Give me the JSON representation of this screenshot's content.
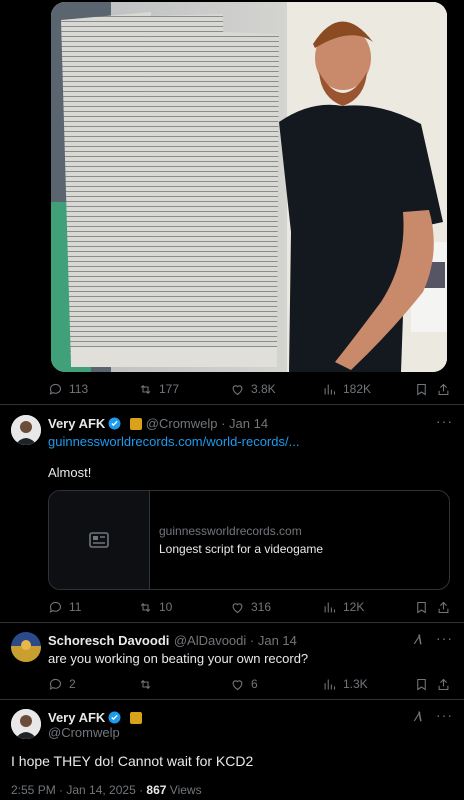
{
  "post1": {
    "stats": {
      "replies": "113",
      "reposts": "177",
      "likes": "3.8K",
      "views": "182K"
    }
  },
  "reply1": {
    "name": "Very AFK",
    "handle": "@Cromwelp · Jan 14",
    "link": "guinnessworldrecords.com/world-records/...",
    "text": "Almost!",
    "card": {
      "domain": "guinnessworldrecords.com",
      "title": "Longest script for a videogame"
    },
    "stats": {
      "replies": "11",
      "reposts": "10",
      "likes": "316",
      "views": "12K"
    }
  },
  "reply2": {
    "name": "Schoresch Davoodi",
    "handle": "@AlDavoodi · Jan 14",
    "text": "are you working on beating your own record?",
    "stats": {
      "replies": "2",
      "reposts": "",
      "likes": "6",
      "views": "1.3K"
    }
  },
  "reply3": {
    "name": "Very AFK",
    "handle": "@Cromwelp",
    "text": "I hope THEY do! Cannot wait for KCD2",
    "meta_time": "2:55 PM · Jan 14, 2025 · ",
    "meta_views": "867",
    "meta_views_label": " Views"
  },
  "colors": {
    "accent": "#1d9bf0",
    "muted": "#71767b",
    "bg": "#000000"
  }
}
